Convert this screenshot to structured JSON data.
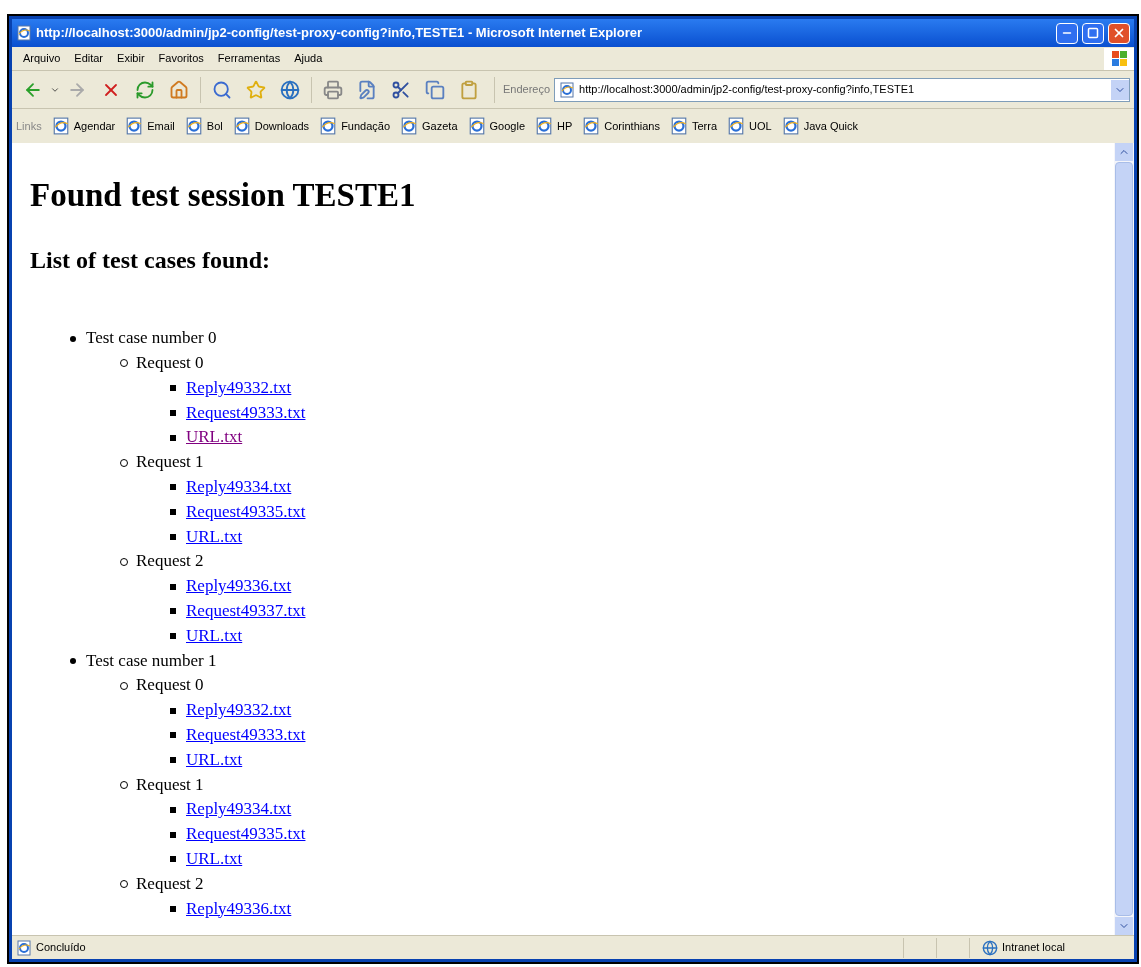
{
  "window": {
    "title": "http://localhost:3000/admin/jp2-config/test-proxy-config?info,TESTE1 - Microsoft Internet Explorer"
  },
  "menu": [
    "Arquivo",
    "Editar",
    "Exibir",
    "Favoritos",
    "Ferramentas",
    "Ajuda"
  ],
  "address_bar": {
    "label": "Endereço",
    "value": "http://localhost:3000/admin/jp2-config/test-proxy-config?info,TESTE1"
  },
  "links_bar": {
    "label": "Links",
    "items": [
      "Agendar",
      "Email",
      "Bol",
      "Downloads",
      "Fundação",
      "Gazeta",
      "Google",
      "HP",
      "Corinthians",
      "Terra",
      "UOL",
      "Java Quick"
    ]
  },
  "page": {
    "heading": "Found test session TESTE1",
    "subheading": "List of test cases found:",
    "test_cases": [
      {
        "label": "Test case number 0",
        "requests": [
          {
            "label": "Request 0",
            "files": [
              {
                "name": "Reply49332.txt",
                "visited": false
              },
              {
                "name": "Request49333.txt",
                "visited": false
              },
              {
                "name": "URL.txt",
                "visited": true
              }
            ]
          },
          {
            "label": "Request 1",
            "files": [
              {
                "name": "Reply49334.txt",
                "visited": false
              },
              {
                "name": "Request49335.txt",
                "visited": false
              },
              {
                "name": "URL.txt",
                "visited": false
              }
            ]
          },
          {
            "label": "Request 2",
            "files": [
              {
                "name": "Reply49336.txt",
                "visited": false
              },
              {
                "name": "Request49337.txt",
                "visited": false
              },
              {
                "name": "URL.txt",
                "visited": false
              }
            ]
          }
        ]
      },
      {
        "label": "Test case number 1",
        "requests": [
          {
            "label": "Request 0",
            "files": [
              {
                "name": "Reply49332.txt",
                "visited": false
              },
              {
                "name": "Request49333.txt",
                "visited": false
              },
              {
                "name": "URL.txt",
                "visited": false
              }
            ]
          },
          {
            "label": "Request 1",
            "files": [
              {
                "name": "Reply49334.txt",
                "visited": false
              },
              {
                "name": "Request49335.txt",
                "visited": false
              },
              {
                "name": "URL.txt",
                "visited": false
              }
            ]
          },
          {
            "label": "Request 2",
            "files": [
              {
                "name": "Reply49336.txt",
                "visited": false
              }
            ]
          }
        ]
      }
    ]
  },
  "status_bar": {
    "text": "Concluído",
    "zone": "Intranet local"
  }
}
